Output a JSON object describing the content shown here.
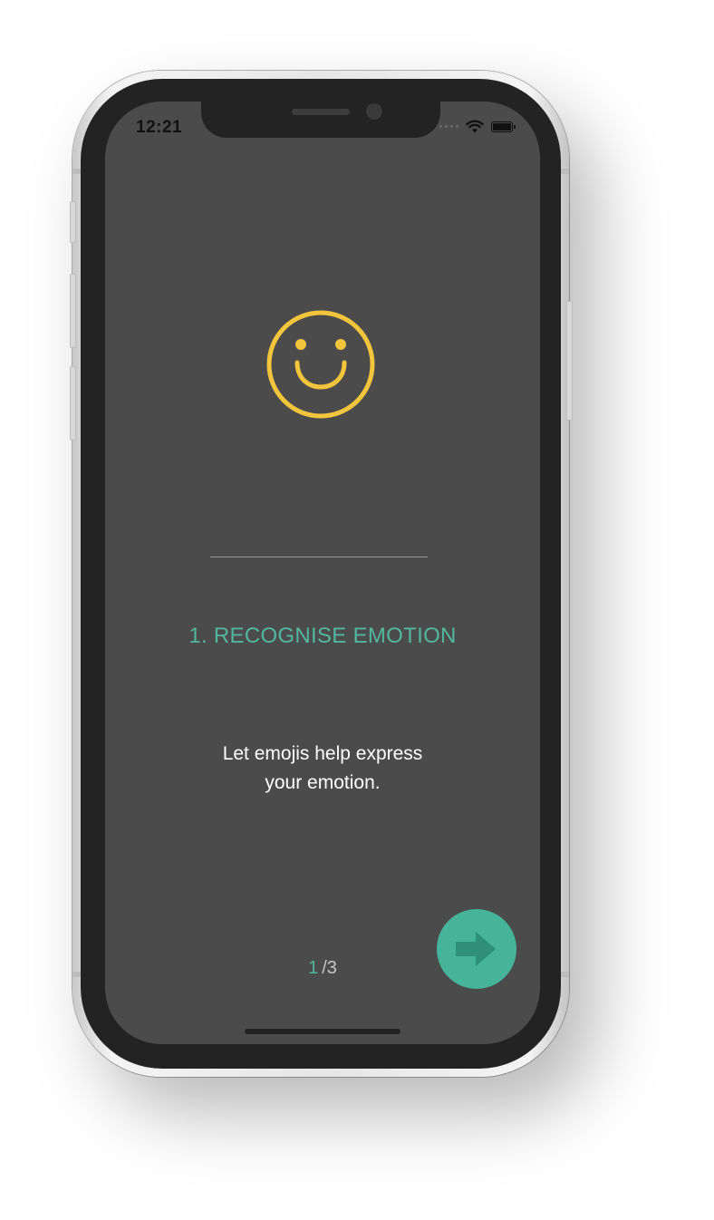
{
  "status_bar": {
    "time": "12:21",
    "wifi_icon": "wifi-icon",
    "battery_icon": "battery-icon"
  },
  "illustration": {
    "icon": "smiley-face-icon",
    "color": "#f2c53d"
  },
  "onboarding": {
    "title": "1. RECOGNISE EMOTION",
    "description_line1": "Let emojis help express",
    "description_line2": "your emotion."
  },
  "pager": {
    "current": "1",
    "total": "/3"
  },
  "next_button": {
    "icon": "arrow-right-icon",
    "color": "#45b49b"
  },
  "colors": {
    "accent": "#52b6a0",
    "screen_background": "#4b4b4b",
    "text": "#ffffff"
  }
}
